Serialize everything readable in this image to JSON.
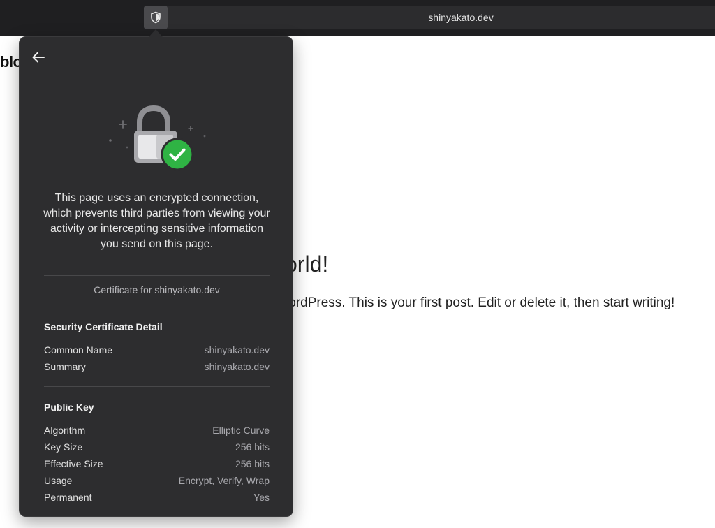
{
  "address_bar": {
    "url": "shinyakato.dev"
  },
  "background_page": {
    "logo_partial": "blo",
    "post_title_partial": "orld!",
    "post_body_partial": "/ordPress. This is your first post. Edit or delete it, then start writing!"
  },
  "popover": {
    "description": "This page uses an encrypted connection, which prevents third parties from viewing your activity or intercepting sensitive information you send on this page.",
    "certificate_for": "Certificate for shinyakato.dev",
    "sections": [
      {
        "title": "Security Certificate Detail",
        "rows": [
          {
            "label": "Common Name",
            "value": "shinyakato.dev"
          },
          {
            "label": "Summary",
            "value": "shinyakato.dev"
          }
        ]
      },
      {
        "title": "Public Key",
        "rows": [
          {
            "label": "Algorithm",
            "value": "Elliptic Curve"
          },
          {
            "label": "Key Size",
            "value": "256 bits"
          },
          {
            "label": "Effective Size",
            "value": "256 bits"
          },
          {
            "label": "Usage",
            "value": "Encrypt, Verify, Wrap"
          },
          {
            "label": "Permanent",
            "value": "Yes"
          }
        ]
      }
    ]
  },
  "icons": {
    "shield": "shield-icon",
    "back": "back-arrow-icon",
    "lock": "padlock-icon",
    "check": "checkmark-badge-icon"
  },
  "colors": {
    "toolbar": "#1f1f21",
    "popover_bg": "#2d2d2f",
    "check_green": "#2fb344"
  }
}
